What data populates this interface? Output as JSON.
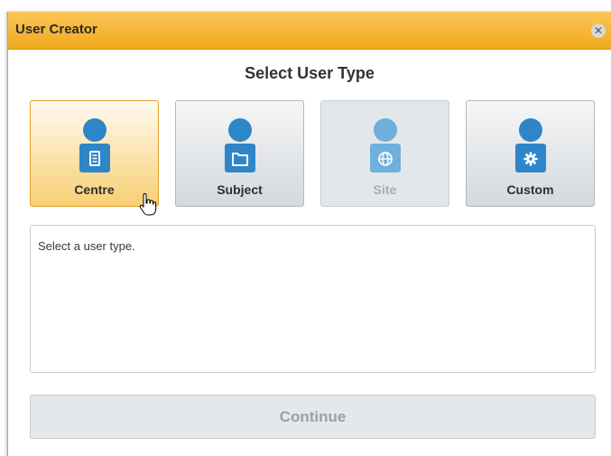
{
  "window": {
    "title": "User Creator",
    "close_icon": "close-icon"
  },
  "dialog": {
    "heading": "Select User Type",
    "user_types": [
      {
        "label": "Centre",
        "icon": "building-icon",
        "state": "selected"
      },
      {
        "label": "Subject",
        "icon": "folder-icon",
        "state": "normal"
      },
      {
        "label": "Site",
        "icon": "globe-icon",
        "state": "disabled"
      },
      {
        "label": "Custom",
        "icon": "gear-icon",
        "state": "normal"
      }
    ],
    "description": "Select a user type.",
    "continue_label": "Continue"
  },
  "colors": {
    "accent": "#f0a91c",
    "user_icon": "#2e86c9",
    "user_icon_disabled": "#6fb0dd"
  }
}
